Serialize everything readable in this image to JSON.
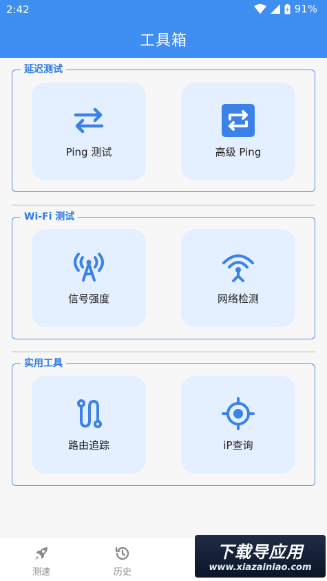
{
  "status": {
    "time": "2:42",
    "battery": "91%"
  },
  "header": {
    "title": "工具箱"
  },
  "sections": [
    {
      "label": "延迟测试",
      "tiles": [
        {
          "label": "Ping 测试",
          "icon": "swap-arrows-icon"
        },
        {
          "label": "高级 Ping",
          "icon": "repeat-square-icon"
        }
      ]
    },
    {
      "label": "Wi-Fi 测试",
      "tiles": [
        {
          "label": "信号强度",
          "icon": "antenna-signal-icon"
        },
        {
          "label": "网络检测",
          "icon": "wifi-tower-icon"
        }
      ]
    },
    {
      "label": "实用工具",
      "tiles": [
        {
          "label": "路由追踪",
          "icon": "route-icon"
        },
        {
          "label": "iP查询",
          "icon": "target-icon"
        }
      ]
    }
  ],
  "bottom_nav": [
    {
      "label": "测速",
      "icon": "rocket-icon"
    },
    {
      "label": "历史",
      "icon": "history-icon"
    }
  ],
  "watermark": {
    "title": "下载导应用",
    "url": "www.xiazainiao.com"
  },
  "colors": {
    "primary": "#3f8ef1",
    "tile_bg": "#e4efff",
    "section_border": "#4a8fea",
    "section_label": "#2f7be6"
  }
}
